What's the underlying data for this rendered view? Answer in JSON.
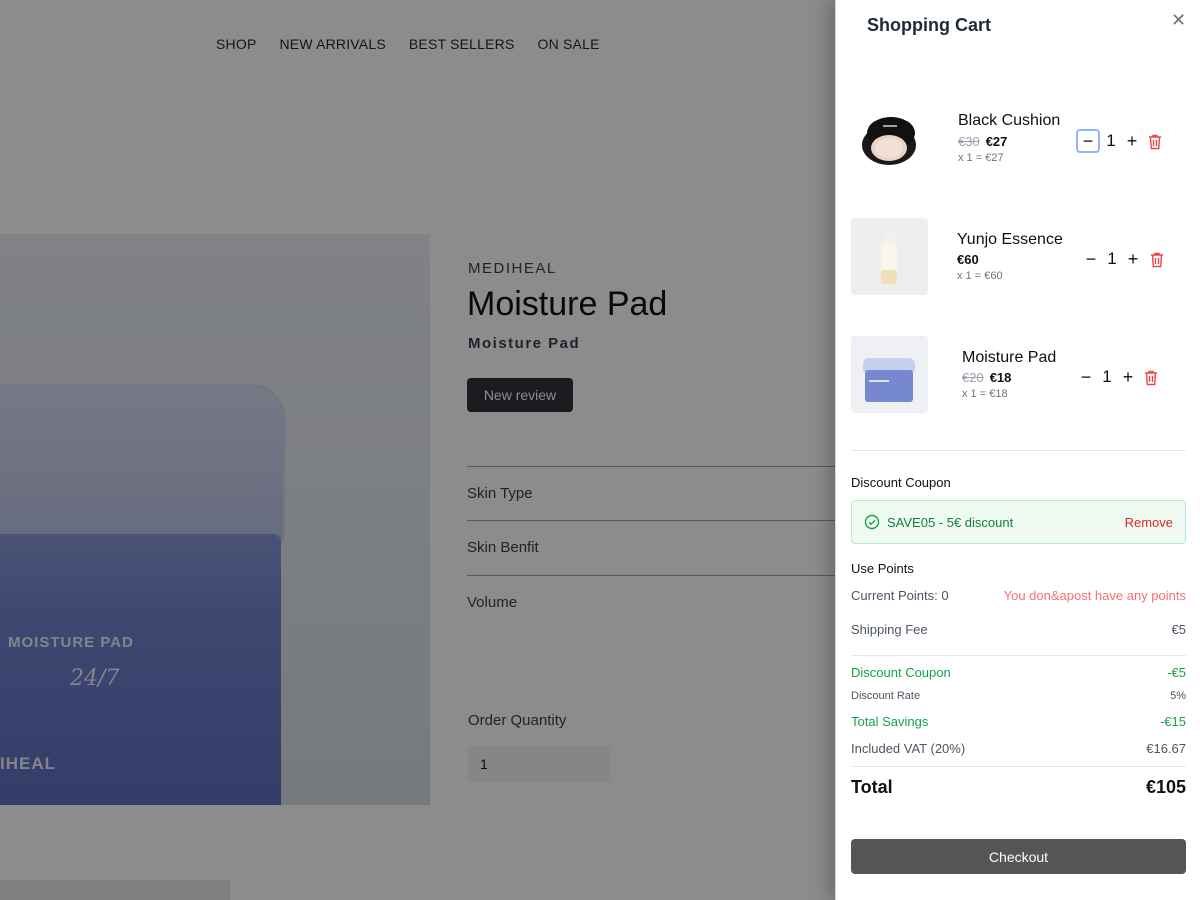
{
  "nav": {
    "items": [
      "SHOP",
      "NEW ARRIVALS",
      "BEST SELLERS",
      "ON SALE"
    ]
  },
  "product": {
    "brand": "MEDIHEAL",
    "title": "Moisture Pad",
    "subtitle": "Moisture Pad",
    "review_button": "New review",
    "accordion": [
      "Skin Type",
      "Skin Benfit",
      "Volume"
    ],
    "order_quantity_label": "Order Quantity",
    "order_quantity_value": "1",
    "image_text": {
      "brand_top": "MOISTURE PAD",
      "tag": "24/7",
      "brand_bottom": "IHEAL"
    }
  },
  "cart": {
    "title": "Shopping Cart",
    "close_icon": "close-icon",
    "items": [
      {
        "name": "Black Cushion",
        "old_price": "€30",
        "price": "€27",
        "calc": "x 1 = €27",
        "qty": "1",
        "thumb_icon": "cushion-compact-icon"
      },
      {
        "name": "Yunjo Essence",
        "old_price": "",
        "price": "€60",
        "calc": "x 1 = €60",
        "qty": "1",
        "thumb_icon": "essence-bottle-icon"
      },
      {
        "name": "Moisture Pad",
        "old_price": "€20",
        "price": "€18",
        "calc": "x 1 = €18",
        "qty": "1",
        "thumb_icon": "moisture-pad-jar-icon"
      }
    ],
    "minus_symbol": "−",
    "plus_symbol": "+",
    "discount": {
      "label": "Discount Coupon",
      "code_text": "SAVE05 - 5€ discount",
      "remove": "Remove"
    },
    "points": {
      "label": "Use Points",
      "current": "Current Points: 0",
      "warning": "You don&apost have any points"
    },
    "shipping": {
      "label": "Shipping Fee",
      "value": "€5"
    },
    "summary": {
      "discount_coupon": {
        "label": "Discount Coupon",
        "value": "-€5"
      },
      "discount_rate": {
        "label": "Discount Rate",
        "value": "5%"
      },
      "total_savings": {
        "label": "Total Savings",
        "value": "-€15"
      },
      "vat": {
        "label": "Included VAT (20%)",
        "value": "€16.67"
      }
    },
    "total": {
      "label": "Total",
      "value": "€105"
    },
    "checkout": "Checkout"
  },
  "colors": {
    "overlay": "#000000",
    "coupon_green": "#15803d",
    "coupon_bg": "#effbf2",
    "remove_red": "#dc2626",
    "trash_red": "#ef4444",
    "checkout_bg": "#555555",
    "review_bg": "#2f3237"
  }
}
